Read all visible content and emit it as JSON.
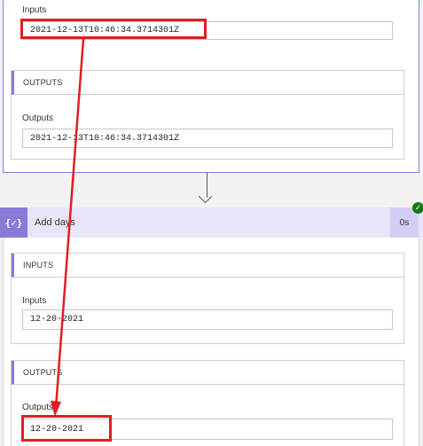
{
  "step1": {
    "inputs_label": "Inputs",
    "inputs_value": "2021-12-13T10:46:34.3714301Z",
    "outputs_section_title": "OUTPUTS",
    "outputs_label": "Outputs",
    "outputs_value": "2021-12-13T10:46:34.3714301Z"
  },
  "action": {
    "icon_symbol": "{✓}",
    "icon_name": "expression-icon",
    "title": "Add days",
    "duration": "0s",
    "status": "succeeded"
  },
  "step2": {
    "inputs_section_title": "INPUTS",
    "inputs_label": "Inputs",
    "inputs_value": "12-20-2021",
    "outputs_section_title": "OUTPUTS",
    "outputs_label": "Outputs",
    "outputs_value": "12-20-2021"
  },
  "colors": {
    "accent": "#8b79d9",
    "annotation_red": "#e01e25",
    "success": "#107c10"
  }
}
